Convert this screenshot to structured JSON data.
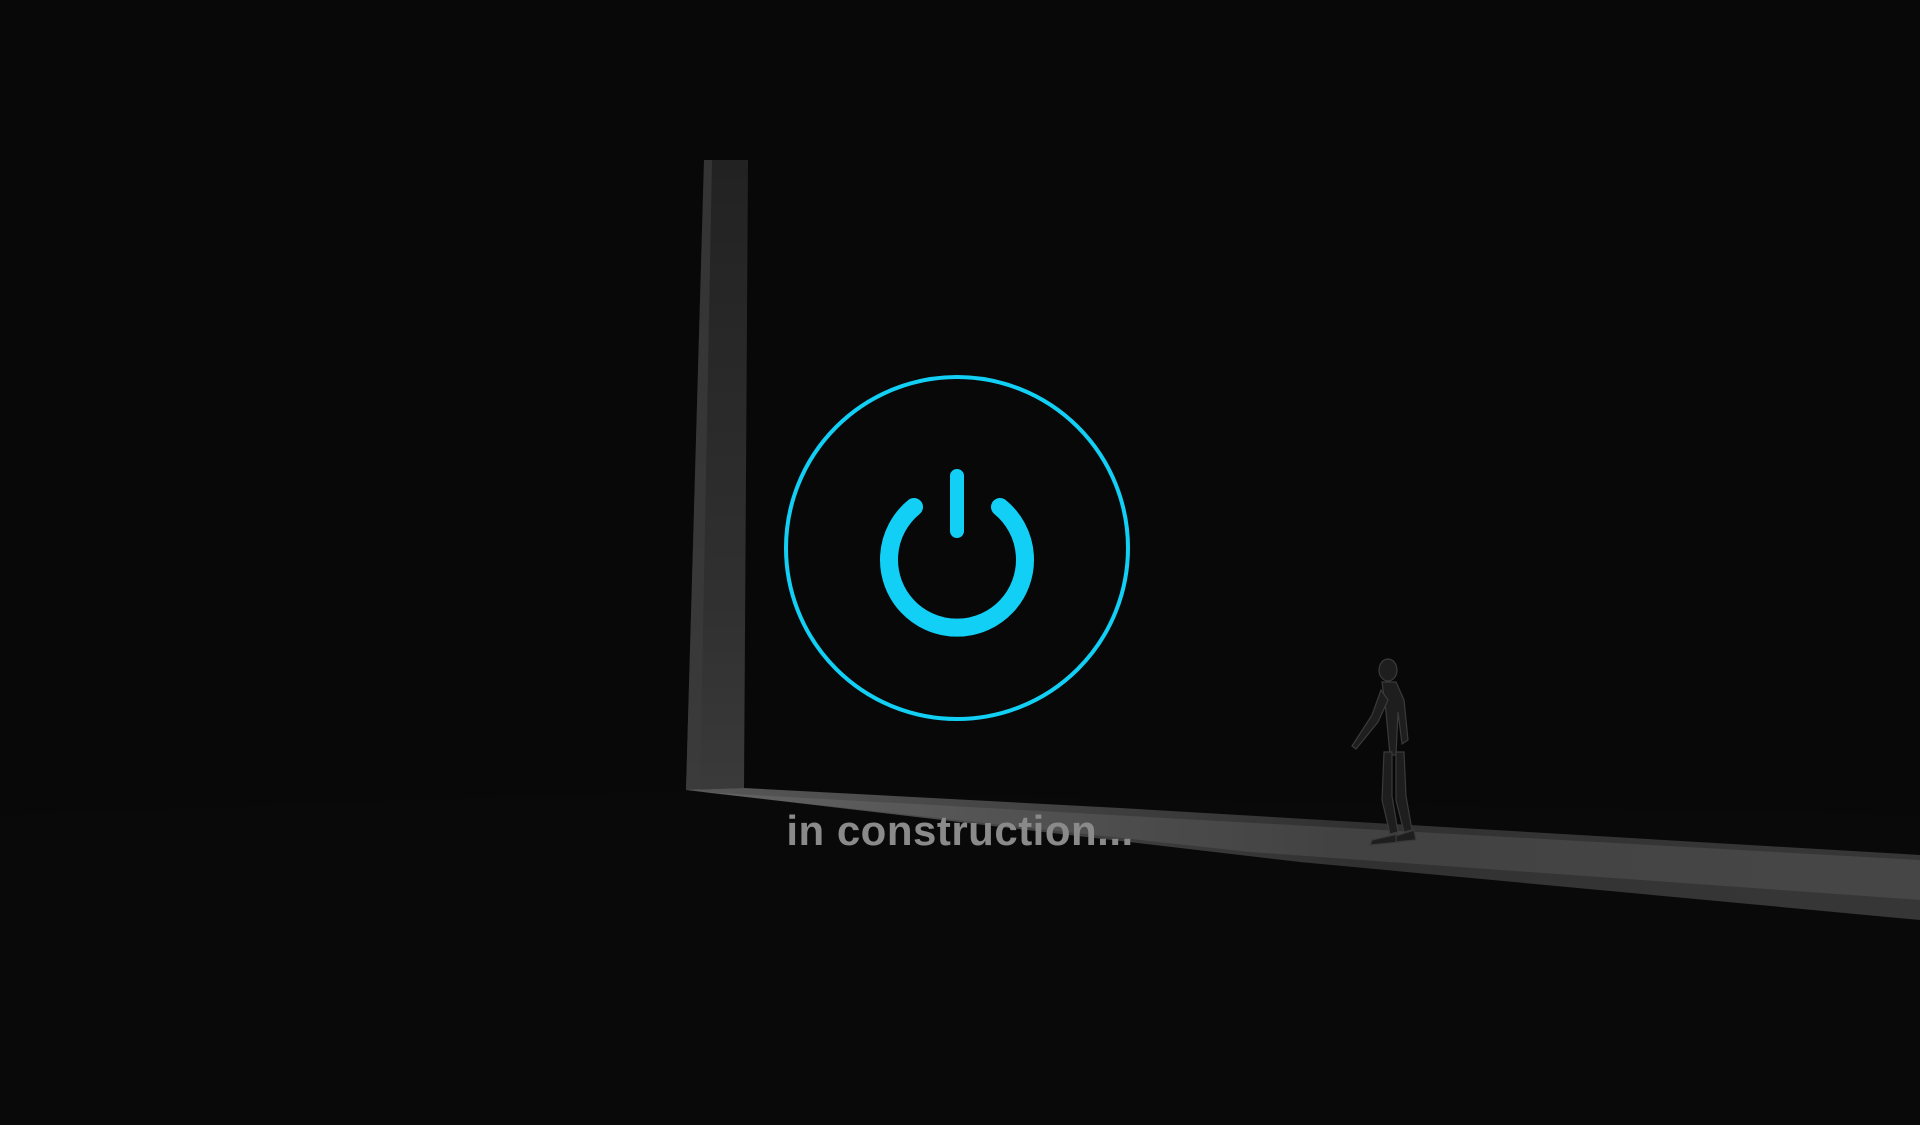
{
  "status": {
    "text": "in construction..."
  },
  "power_button": {
    "icon": "power-icon",
    "accent_color": "#12d0f5"
  },
  "scene": {
    "background_color": "#080808",
    "elements": [
      "door-frame",
      "light-beam",
      "figure-silhouette"
    ]
  }
}
